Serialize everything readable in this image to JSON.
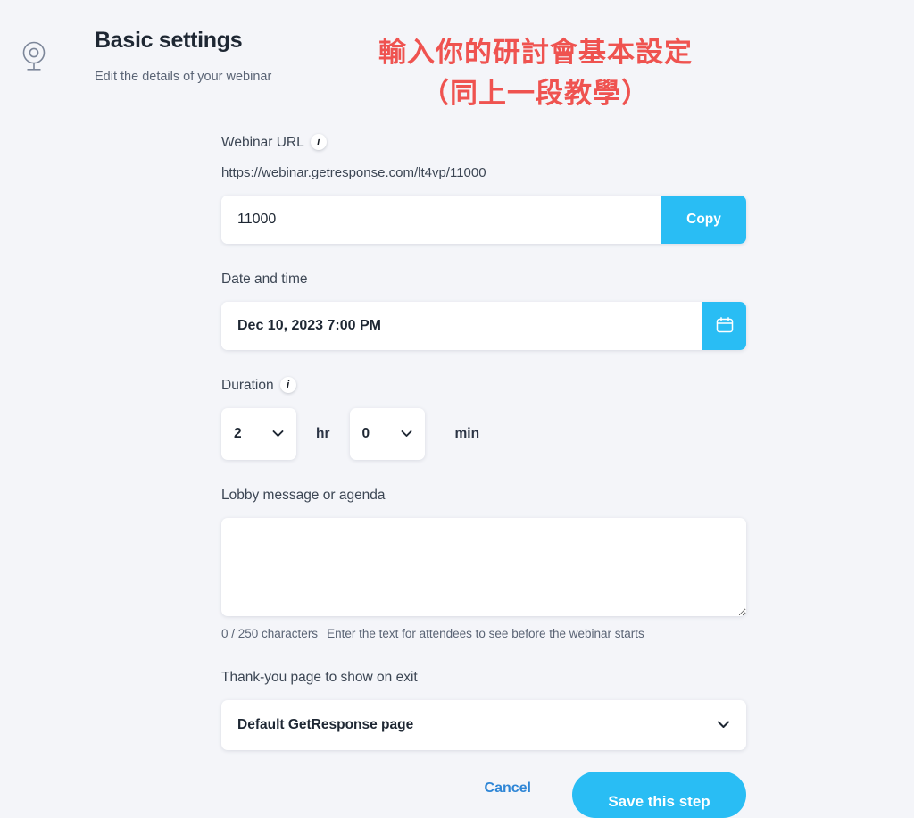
{
  "header": {
    "icon": "webcam-icon",
    "title": "Basic settings",
    "subtitle": "Edit the details of your webinar"
  },
  "annotation": {
    "line1": "輸入你的研討會基本設定",
    "line2": "（同上一段教學）",
    "color": "#ef5350"
  },
  "theme": {
    "background": "#f4f5f9",
    "accent": "#29bdf4",
    "link": "#2f86d6",
    "text": "#1e2733"
  },
  "form": {
    "webinar_url": {
      "label": "Webinar URL",
      "info_icon": "info-icon",
      "preview": "https://webinar.getresponse.com/lt4vp/11000",
      "value": "11000",
      "placeholder": "",
      "copy_label": "Copy"
    },
    "date_time": {
      "label": "Date and time",
      "value": "Dec 10, 2023 7:00 PM",
      "calendar_icon": "calendar-icon"
    },
    "duration": {
      "label": "Duration",
      "info_icon": "info-icon",
      "hours_value": "2",
      "hours_unit": "hr",
      "minutes_value": "0",
      "minutes_unit": "min"
    },
    "lobby": {
      "label": "Lobby message or agenda",
      "value": "",
      "placeholder": "",
      "counter": "0 / 250 characters",
      "hint": "Enter the text for attendees to see before the webinar starts"
    },
    "thank_you": {
      "label": "Thank-you page to show on exit",
      "selected": "Default GetResponse page"
    }
  },
  "footer": {
    "cancel_label": "Cancel",
    "save_label": "Save this step"
  }
}
